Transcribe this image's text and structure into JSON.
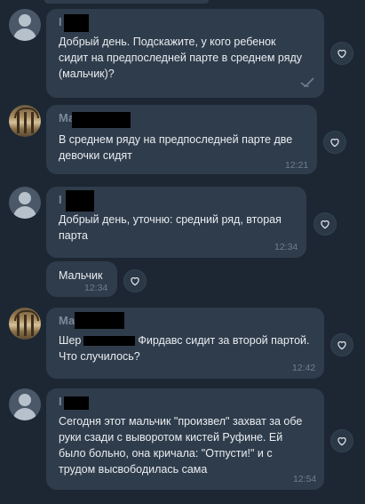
{
  "messages": [
    {
      "sender": "I",
      "text_lines": [
        "Добрый день. Подскажите, у кого ребенок",
        "сидит на предпоследней парте в среднем ряду",
        "(мальчик)?"
      ],
      "time": "",
      "status_icon": "sent-check-icon"
    },
    {
      "sender": "Ма",
      "text_lines": [
        "В среднем ряду на предпоследней парте  две",
        "девочки сидят"
      ],
      "time": "12:21"
    },
    {
      "sender": "I",
      "text_lines": [
        "Добрый день, уточню: средний ряд, вторая",
        "парта"
      ],
      "time": "12:34"
    },
    {
      "sender": "",
      "text_lines": [
        "Мальчик"
      ],
      "time": "12:34"
    },
    {
      "sender": "Ма",
      "text_prefix": "Шер",
      "text_suffix": "Фирдавс сидит за второй партой.",
      "text_lines": [
        "Что случилось?"
      ],
      "time": "12:42"
    },
    {
      "sender": "I",
      "text_lines": [
        "Сегодня этот мальчик \"произвел\" захват за обе",
        "руки сзади с выворотом кистей Руфине. Ей",
        "было больно, она кричала: \"Отпусти!\"  и с",
        "трудом высвободилась сама"
      ],
      "time": "12:54"
    }
  ],
  "colors": {
    "background": "#1c2733",
    "bubble": "#2f3c4b",
    "text": "#e9edf1",
    "time": "#6f7f8f"
  },
  "icons": {
    "reaction": "heart-icon",
    "avatar_default": "user-silhouette-icon",
    "avatar_photo": "photo-avatar"
  }
}
